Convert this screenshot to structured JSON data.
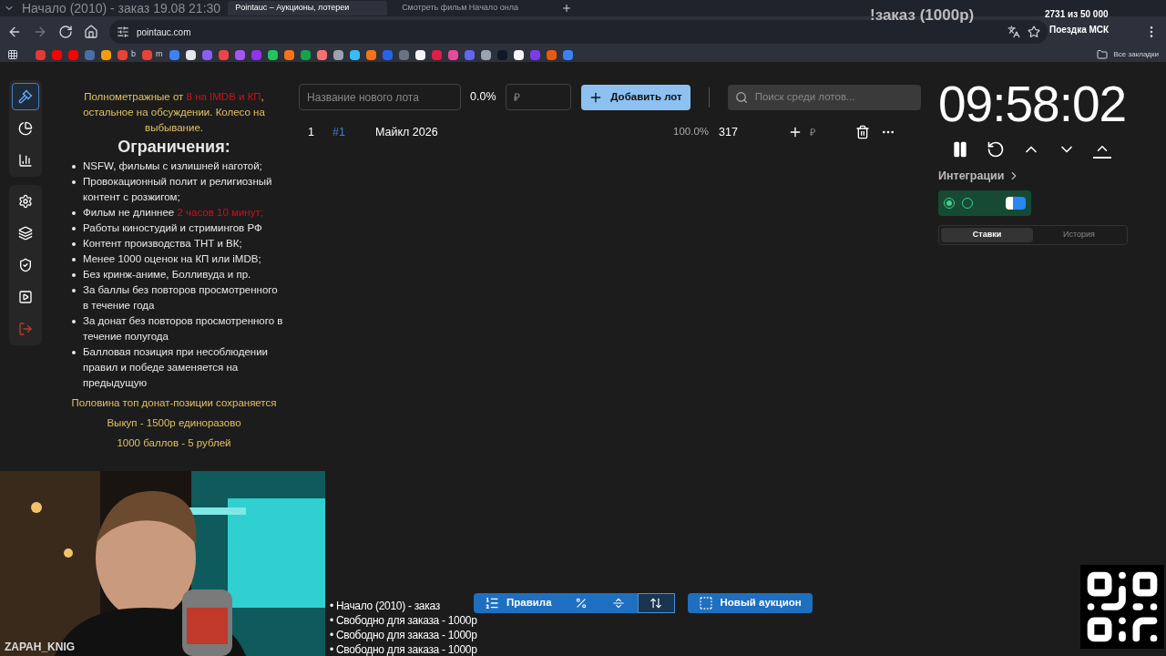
{
  "browser": {
    "tabs": [
      {
        "title": "Pointauc – Аукционы, лотереи",
        "selected": true
      },
      {
        "title": "Смотреть фильм Начало онла",
        "selected": false
      }
    ],
    "address": "pointauc.com",
    "bookmarks": [
      {
        "color": "#e53935"
      },
      {
        "color": "#ff0000"
      },
      {
        "color": "#ff0000"
      },
      {
        "color": "#4a6fa5"
      },
      {
        "color": "#f59e0b"
      },
      {
        "color": "#ea4335",
        "label": "b"
      },
      {
        "color": "#ea4335",
        "label": "m"
      },
      {
        "color": "#3b82f6"
      },
      {
        "color": "#e5e7eb"
      },
      {
        "color": "#8b5cf6"
      },
      {
        "color": "#ef4444"
      },
      {
        "color": "#a855f7"
      },
      {
        "color": "#9333ea"
      },
      {
        "color": "#22c55e"
      },
      {
        "color": "#f97316"
      },
      {
        "color": "#16a34a"
      },
      {
        "color": "#f87171"
      },
      {
        "color": "#9ca3af"
      },
      {
        "color": "#38bdf8"
      },
      {
        "color": "#f97316"
      },
      {
        "color": "#2563eb"
      },
      {
        "color": "#6b7280"
      },
      {
        "color": "#f5f5f5"
      },
      {
        "color": "#e11d48"
      },
      {
        "color": "#ec4899"
      },
      {
        "color": "#6366f1"
      },
      {
        "color": "#9ca3af"
      },
      {
        "color": "#111827"
      },
      {
        "color": "#f5f5f5"
      },
      {
        "color": "#7c3aed"
      },
      {
        "color": "#ea580c"
      },
      {
        "color": "#3b82f6"
      }
    ],
    "all_bookmarks": "Все закладки"
  },
  "stream_overlay": {
    "caption": "Начало (2010) - заказ 19.08 21:30",
    "command": "!заказ (1000р)",
    "goal": "2731  из 50 000",
    "goal_title": "Поездка МСК",
    "username": "ZAPAH_KNIG",
    "queue": [
      "• Начало (2010) - заказ",
      "• Свободно для заказа - 1000р",
      "• Свободно для заказа - 1000р",
      "• Свободно для заказа - 1000р"
    ]
  },
  "sidebar": {
    "groups": [
      [
        {
          "selected": true
        },
        {
          "selected": false
        },
        {
          "selected": false
        }
      ],
      [
        {
          "selected": false
        },
        {
          "selected": false
        },
        {
          "selected": false
        },
        {
          "selected": false
        },
        {
          "selected": false
        }
      ]
    ]
  },
  "rules": {
    "intro": [
      {
        "text": "Полнометражные от ",
        "highlight": false
      },
      {
        "text": "8 на IMDB и КП",
        "highlight": true
      },
      {
        "text": ", остальное на обсуждении. Колесо на выбывание.",
        "highlight": false
      }
    ],
    "heading": "Ограничения:",
    "items": [
      {
        "text": "NSFW, фильмы с излишней наготой;"
      },
      {
        "text": "Провокационный полит и религиозный контент с розжигом;"
      },
      {
        "text": "Фильм не длиннее ",
        "note": "2 часов 10 минут;"
      },
      {
        "text": "Работы киностудий и стримингов РФ"
      },
      {
        "text": "Контент производства ТНТ и ВК;"
      },
      {
        "text": "Менее 1000 оценок на КП или iMDB;"
      },
      {
        "text": "Без кринж-аниме, Болливуда и пр."
      },
      {
        "text": "За баллы без повторов просмотренного в течение года"
      },
      {
        "text": "За донат без повторов просмотренного в течение полугода"
      },
      {
        "text": "Балловая позиция при несоблюдении правил и победе заменяется на предыдущую"
      }
    ],
    "footer": [
      "Половина топ донат-позиции сохраняется",
      "Выкуп - 1500р единоразово",
      "1000 баллов - 5 рублей"
    ]
  },
  "lot_form": {
    "name_placeholder": "Название нового лота",
    "percent": "0.0%",
    "amount_placeholder": "₽",
    "add_button": "Добавить лот",
    "search_placeholder": "Поиск среди лотов..."
  },
  "lots": [
    {
      "index": "1",
      "id": "#1",
      "name": "Майкл 2026",
      "percent": "100.0%",
      "amount": "317",
      "currency": "₽"
    }
  ],
  "timer": {
    "time": "09:58:02"
  },
  "integrations": {
    "title": "Интеграции",
    "items": [
      {
        "connected": true
      },
      {
        "connected": false
      }
    ]
  },
  "history_tabs": [
    {
      "label": "Ставки",
      "selected": true
    },
    {
      "label": "История",
      "selected": false
    }
  ],
  "bottom_toolbar": {
    "rules_button": "Правила",
    "toggles": [
      {
        "selected": false
      },
      {
        "selected": false
      },
      {
        "selected": true
      }
    ],
    "new_auction": "Новый аукцион"
  }
}
